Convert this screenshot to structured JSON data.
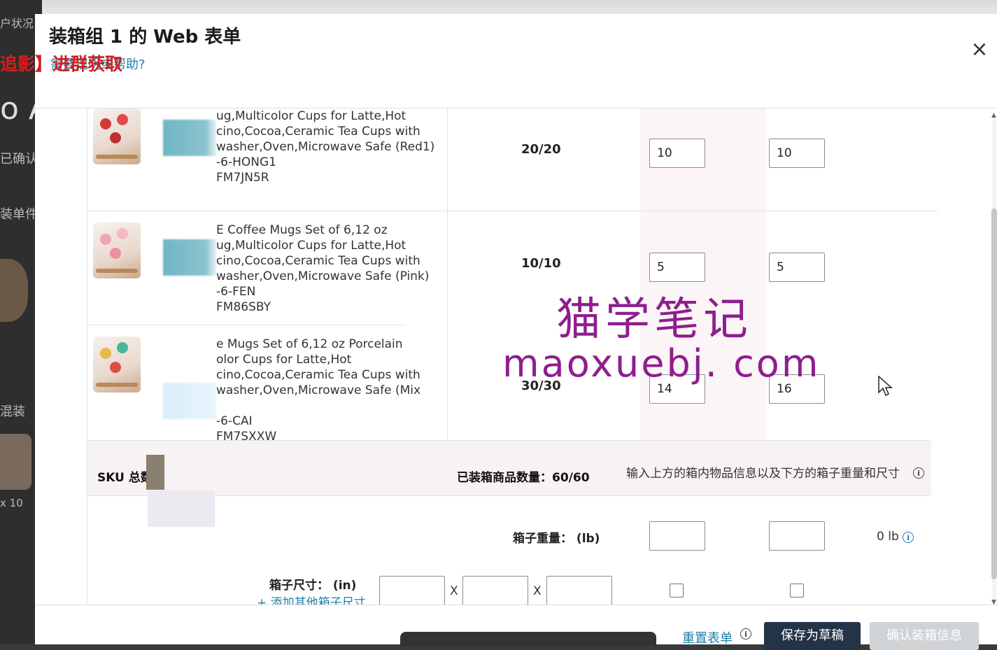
{
  "background_page": {
    "texts": [
      "户状况",
      "o A",
      "已确认",
      "装单件",
      "混装",
      "x 10"
    ]
  },
  "modal": {
    "title": "装箱组 1 的 Web 表单",
    "help_link": "需要说明或帮助?",
    "promo_overlay": "追影】进群获取",
    "close_label": "×"
  },
  "products": [
    {
      "name_lines": "ug,Multicolor Cups for Latte,Hot\ncino,Cocoa,Ceramic Tea Cups with\nwasher,Oven,Microwave Safe (Red1)\n-6-HONG1\nFM7JN5R",
      "quantity": "20/20",
      "box1": "10",
      "box2": "10"
    },
    {
      "name_lines": "E Coffee Mugs Set of 6,12 oz\nug,Multicolor Cups for Latte,Hot\ncino,Cocoa,Ceramic Tea Cups with\nwasher,Oven,Microwave Safe (Pink)\n-6-FEN\nFM86SBY",
      "quantity": "10/10",
      "box1": "5",
      "box2": "5"
    },
    {
      "name_lines": "e Mugs Set of 6,12 oz Porcelain\nolor Cups for Latte,Hot\ncino,Cocoa,Ceramic Tea Cups with\nwasher,Oven,Microwave Safe (Mix\n\n-6-CAI\nFM7SXXW",
      "quantity": "30/30",
      "box1": "14",
      "box2": "16"
    }
  ],
  "summary": {
    "sku_total_label": "SKU 总数",
    "boxed_count": "已装箱商品数量：60/60",
    "hint": "输入上方的箱内物品信息以及下方的箱子重量和尺寸"
  },
  "weight": {
    "label": "箱子重量：  (lb)",
    "total": "0 lb"
  },
  "dimensions": {
    "label": "箱子尺寸：  (in)",
    "add_link": "+ 添加其他箱子尺寸",
    "separator": "X"
  },
  "footer": {
    "reset": "重置表单",
    "save_draft": "保存为草稿",
    "confirm": "确认装箱信息"
  },
  "watermark": {
    "cn": "猫学笔记",
    "en": "maoxuebj. com"
  },
  "colors": {
    "link": "#1f7fa8",
    "primary_button": "#243447",
    "disabled_button": "#cfd3d6",
    "watermark": "#8e1e8e",
    "promo": "#d41e1e"
  }
}
